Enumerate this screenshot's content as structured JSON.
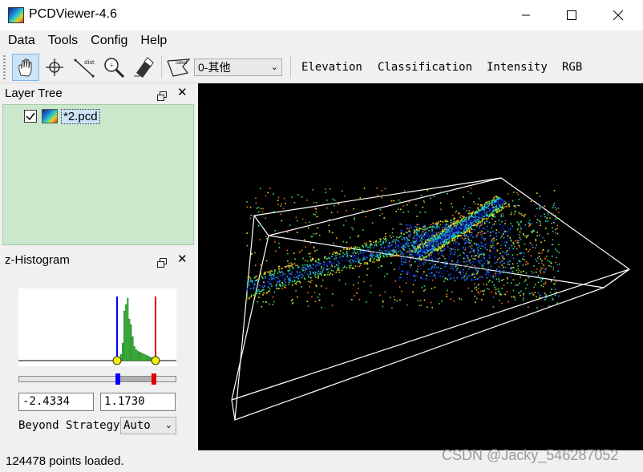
{
  "window": {
    "title": "PCDViewer-4.6"
  },
  "menu": {
    "items": [
      "Data",
      "Tools",
      "Config",
      "Help"
    ]
  },
  "toolbar": {
    "tools": [
      {
        "icon": "pan-hand-icon",
        "active": true
      },
      {
        "icon": "crosshair-icon"
      },
      {
        "icon": "distance-measure-icon",
        "text": "dist"
      },
      {
        "icon": "zoom-icon"
      },
      {
        "icon": "eraser-icon"
      },
      {
        "icon": "label-polygon-icon",
        "text": "label"
      }
    ],
    "class_select_value": "0-其他",
    "render_modes": [
      "Elevation",
      "Classification",
      "Intensity",
      "RGB"
    ]
  },
  "layer_tree": {
    "title": "Layer Tree",
    "items": [
      {
        "label": "*2.pcd",
        "checked": true
      }
    ]
  },
  "histogram": {
    "title": "z-Histogram",
    "min_value": "-2.4334",
    "max_value": "1.1730",
    "beyond_label": "Beyond Strategy",
    "beyond_value": "Auto",
    "colors": {
      "bars": "#2bb52b",
      "min_marker": "#0000ff",
      "max_marker": "#e00000",
      "handle_dot": "#f2f200"
    }
  },
  "status": {
    "text": "124478 points loaded."
  },
  "watermark": "CSDN @Jacky_546287052"
}
